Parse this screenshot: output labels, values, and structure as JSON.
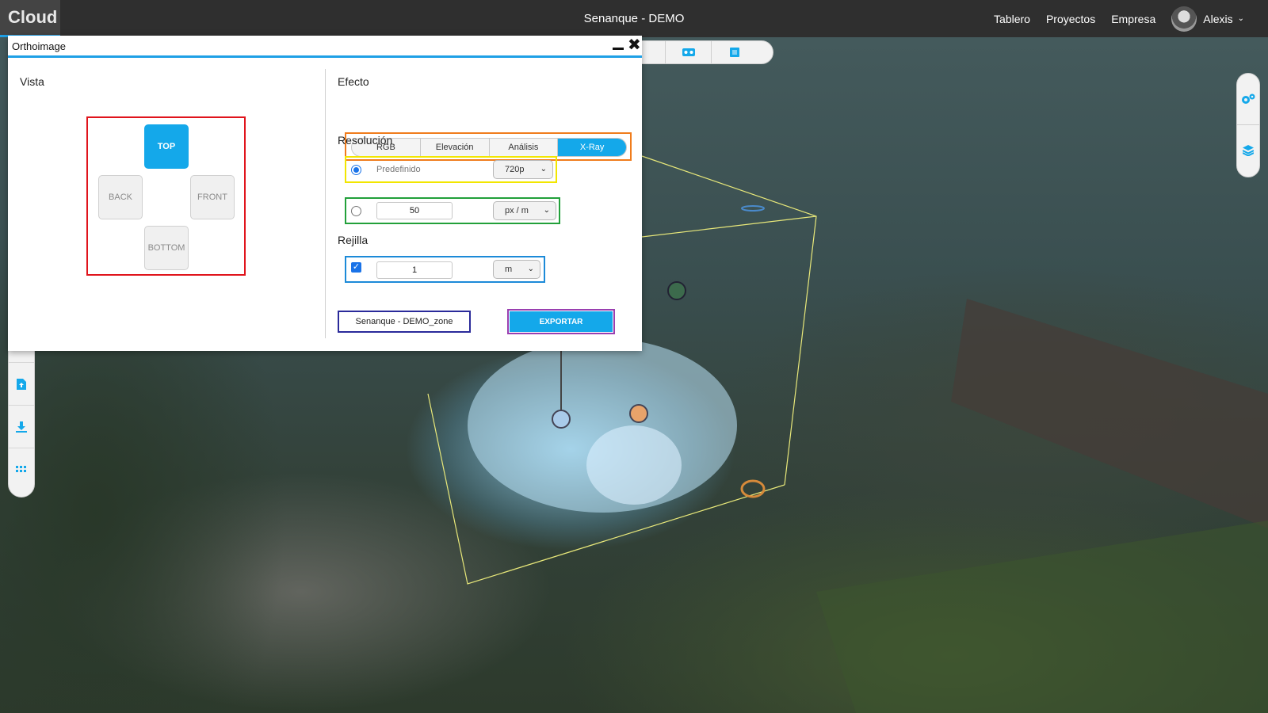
{
  "app": {
    "brand": "Cloud",
    "project_title": "Senanque - DEMO"
  },
  "nav": {
    "links": [
      "Tablero",
      "Proyectos",
      "Empresa"
    ],
    "user": {
      "name": "Alexis",
      "chevron": "❯"
    }
  },
  "dialog": {
    "title": "Orthoimage",
    "vista": {
      "label": "Vista",
      "buttons": {
        "top": "TOP",
        "back": "BACK",
        "front": "FRONT",
        "bottom": "BOTTOM"
      },
      "selected": "TOP"
    },
    "efecto": {
      "label": "Efecto",
      "tabs": [
        "RGB",
        "Elevación",
        "Análisis",
        "X-Ray"
      ],
      "selected": "X-Ray"
    },
    "resolucion": {
      "label": "Resolución",
      "preset": {
        "label": "Predefinido",
        "value": "720p",
        "checked": true
      },
      "custom": {
        "value": "50",
        "unit": "px / m",
        "checked": false
      }
    },
    "rejilla": {
      "label": "Rejilla",
      "checked": true,
      "value": "1",
      "unit": "m"
    },
    "zone_name": "Senanque - DEMO_zone",
    "export_label": "EXPORTAR"
  },
  "colors": {
    "accent": "#14a8ea",
    "topbar": "#2f2f2f",
    "annotation_red": "#e0141c",
    "annotation_orange": "#f07c1c",
    "annotation_yellow": "#f2e600",
    "annotation_green": "#22a03a",
    "annotation_blue": "#1c8ad8",
    "annotation_navy": "#2a2a9a",
    "annotation_purple": "#9a3fb0"
  },
  "icons": {
    "view_toolbar": [
      "vr-headset-icon",
      "cube-view-icon"
    ],
    "right_toolbar": [
      "gears-icon",
      "layers-icon"
    ],
    "left_toolbar": [
      "upload-file-icon",
      "download-icon",
      "grid-apps-icon"
    ]
  }
}
